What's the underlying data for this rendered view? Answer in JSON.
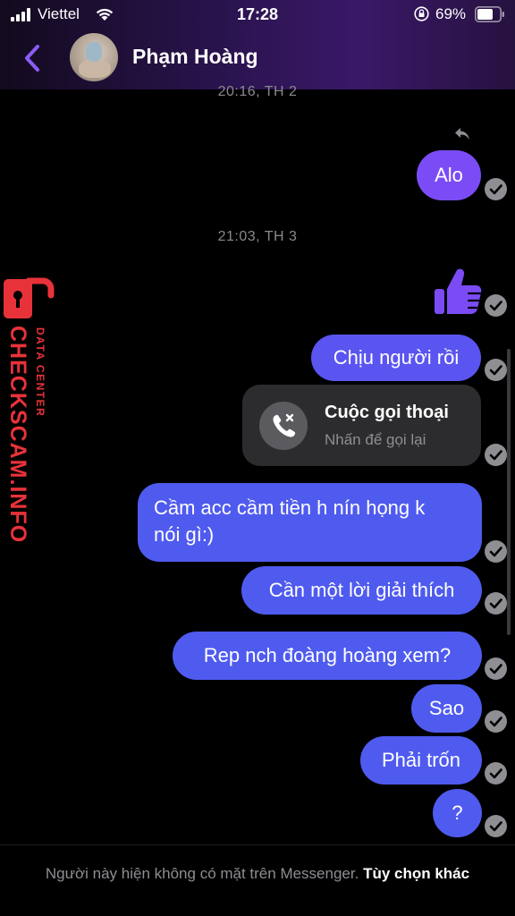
{
  "status_bar": {
    "carrier": "Viettel",
    "time": "17:28",
    "battery": "69%"
  },
  "header": {
    "contact_name": "Phạm Hoàng",
    "back_icon": "chevron-left-icon",
    "avatar": "contact-avatar"
  },
  "thread": {
    "timestamps": [
      "20:16, TH 2",
      "21:03, TH 3"
    ],
    "messages": [
      {
        "text": "Alo",
        "type": "text"
      },
      {
        "text": "",
        "type": "like"
      },
      {
        "text": "Chịu người rồi",
        "type": "text"
      },
      {
        "text": "",
        "type": "call"
      },
      {
        "text": "Cầm acc cầm tiền h nín họng k nói gì:)",
        "type": "text"
      },
      {
        "text": "Cần một lời giải thích",
        "type": "text"
      },
      {
        "text": "Rep nch đoàng hoàng xem?",
        "type": "text"
      },
      {
        "text": "Sao",
        "type": "text"
      },
      {
        "text": "Phải trốn",
        "type": "text"
      },
      {
        "text": "?",
        "type": "text"
      }
    ],
    "call_card": {
      "title": "Cuộc gọi thoại",
      "subtitle": "Nhấn để gọi lại"
    },
    "reply_icon": "reply-icon",
    "message_line1": "Cầm acc cầm tiền h nín họng k",
    "message_line2": "nói gì:)"
  },
  "footer": {
    "text": "Người này hiện không có mặt trên Messenger.",
    "link": "Tùy chọn khác"
  },
  "watermark": {
    "brand": "CHECKSCAM.INFO",
    "tagline": "DATA CENTER"
  },
  "colors": {
    "bubble_purple": "#7b4cf5",
    "bubble_blue": "#4f5bef",
    "accent": "#8b5cf6",
    "watermark_red": "#e8323a"
  }
}
